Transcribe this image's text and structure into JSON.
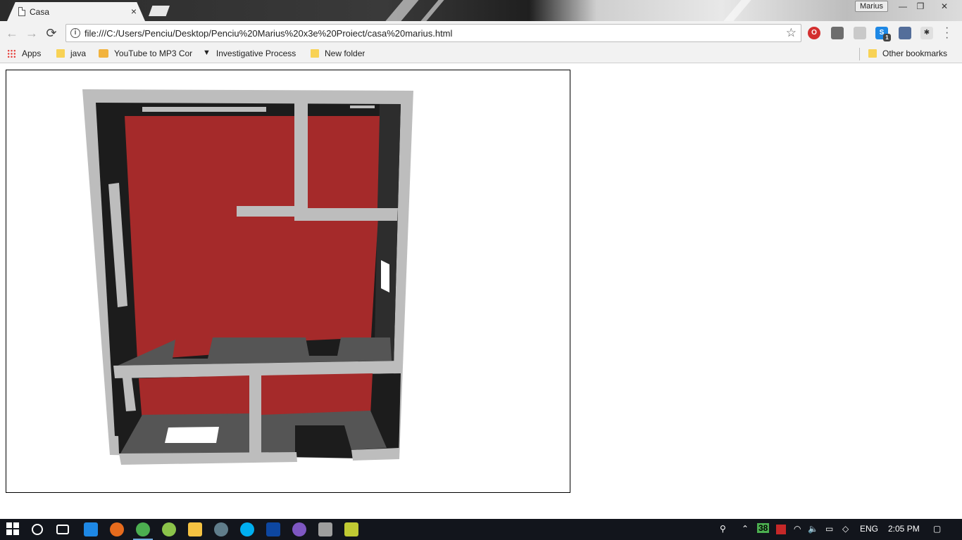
{
  "tab": {
    "title": "Casa",
    "close": "×"
  },
  "user": {
    "name": "Marius"
  },
  "window_controls": {
    "minimize": "—",
    "restore": "❐",
    "close": "✕"
  },
  "toolbar": {
    "back": "←",
    "forward": "→",
    "reload": "⟳",
    "url": "file:///C:/Users/Penciu/Desktop/Penciu%20Marius%20x3e%20Proiect/casa%20marius.html",
    "info_icon": "i",
    "star": "☆",
    "ext_skype_badge": "1"
  },
  "bookmarks": {
    "apps": "Apps",
    "items": [
      "java",
      "YouTube to MP3 Cor",
      "Investigative Process",
      "New folder"
    ],
    "other": "Other bookmarks"
  },
  "scene": {
    "description_colors": {
      "floor": "#a52a2a",
      "wall_top": "#bdbdbd",
      "wall_side": "#555555",
      "shadow": "#1a1a1a"
    }
  },
  "taskbar": {
    "tray_number": "38",
    "language": "ENG",
    "time": "2:05 PM"
  }
}
